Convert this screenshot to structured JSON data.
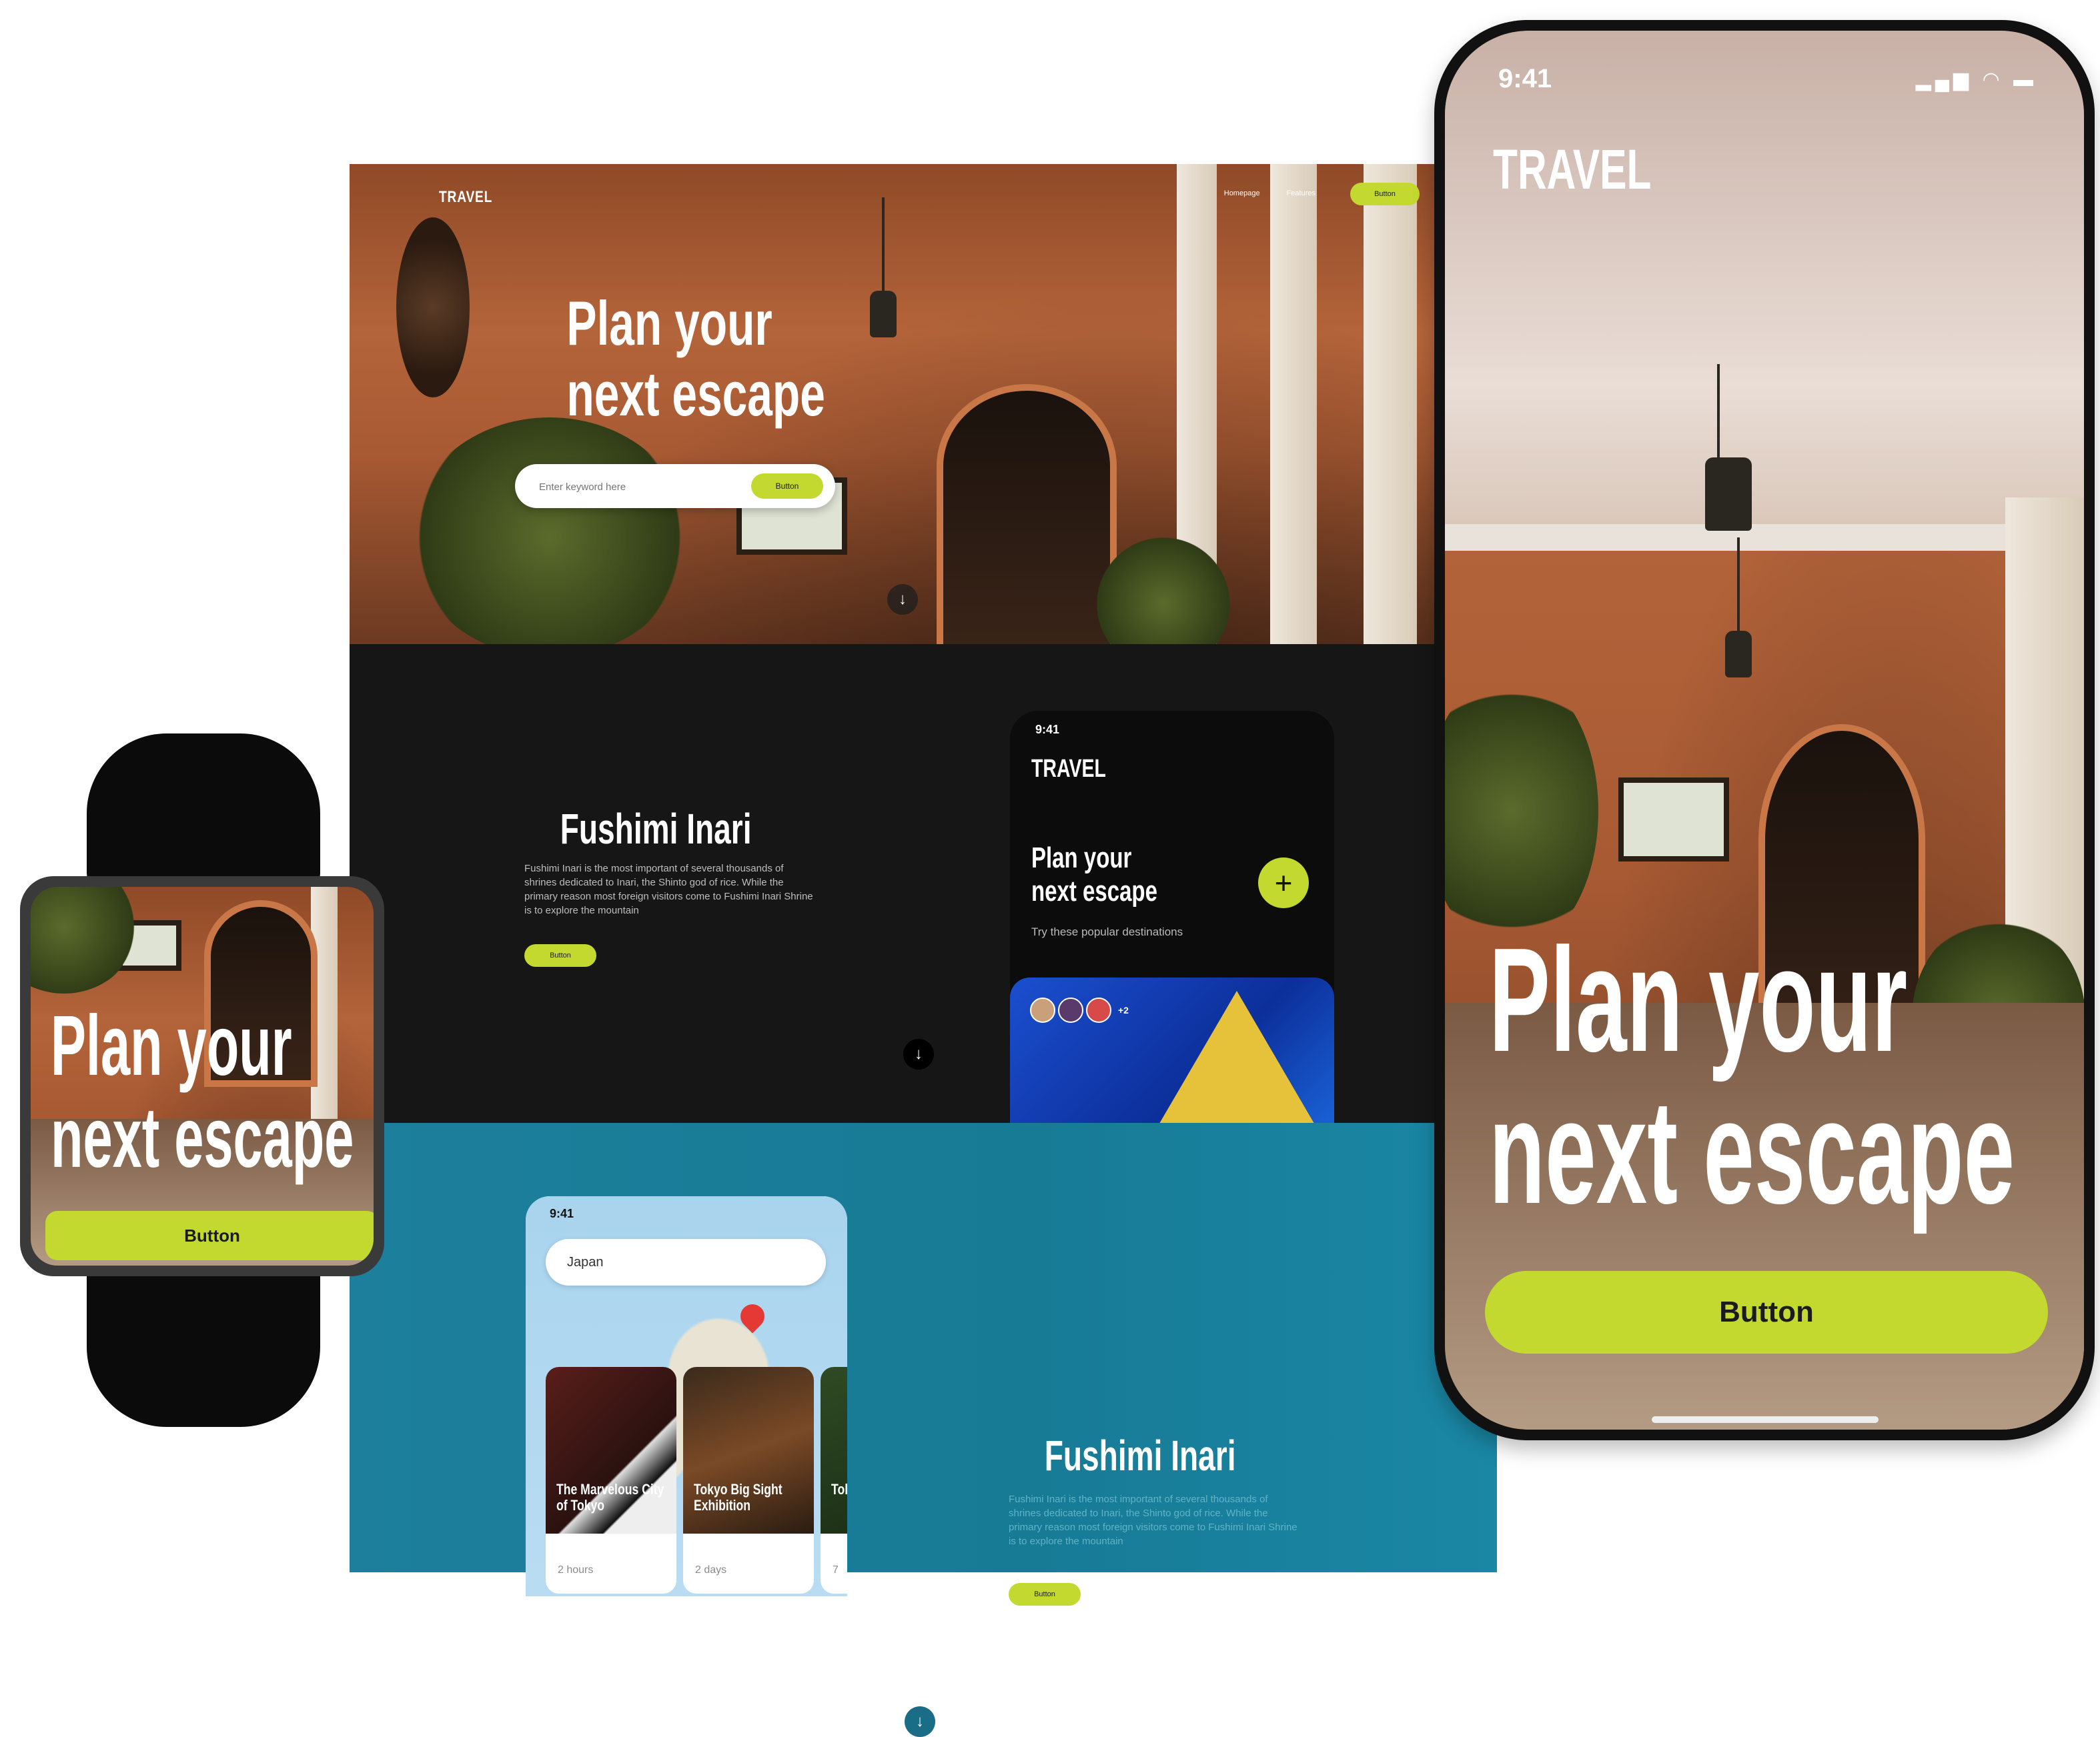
{
  "desktop": {
    "hero": {
      "logo": "TRAVEL",
      "nav_links": [
        "Homepage",
        "Features"
      ],
      "nav_button": "Button",
      "title_line1": "Plan your",
      "title_line2": "next escape",
      "search_placeholder": "Enter keyword here",
      "search_button": "Button",
      "scroll_icon": "↓"
    },
    "dark_section": {
      "title": "Fushimi Inari",
      "body": "Fushimi Inari is the most important of several thousands of shrines dedicated to Inari, the Shinto god of rice. While the primary reason most foreign visitors come to Fushimi Inari Shrine is to explore the mountain",
      "button": "Button",
      "scroll_icon": "↓",
      "phone": {
        "time": "9:41",
        "logo": "TRAVEL",
        "title_line1": "Plan your",
        "title_line2": "next escape",
        "subtitle": "Try these popular destinations",
        "plus_icon": "+",
        "avatar_extra": "+2"
      }
    },
    "blue_section": {
      "title": "Fushimi Inari",
      "body": "Fushimi Inari is the most important of several thousands of shrines dedicated to Inari, the Shinto god of rice. While the primary reason most foreign visitors come to Fushimi Inari Shrine is to explore the mountain",
      "button": "Button",
      "scroll_icon": "↓",
      "phone": {
        "time": "9:41",
        "search_value": "Japan",
        "cards": [
          {
            "name": "The Marvelous City of Tokyo",
            "duration": "2 hours"
          },
          {
            "name": "Tokyo Big Sight Exhibition",
            "duration": "2 days"
          },
          {
            "name": "Tok Exi",
            "duration": "7"
          }
        ]
      }
    }
  },
  "watch": {
    "title_line1": "Plan your",
    "title_line2": "next escape",
    "button": "Button"
  },
  "phone": {
    "time": "9:41",
    "logo": "TRAVEL",
    "title_line1": "Plan your",
    "title_line2": "next escape",
    "button": "Button",
    "status_icons": "signal-icon wifi-icon battery-icon"
  },
  "colors": {
    "accent": "#c3d92f",
    "dark_bg": "#161616",
    "teal_bg": "#1d7f9b",
    "terracotta": "#b4643a"
  }
}
